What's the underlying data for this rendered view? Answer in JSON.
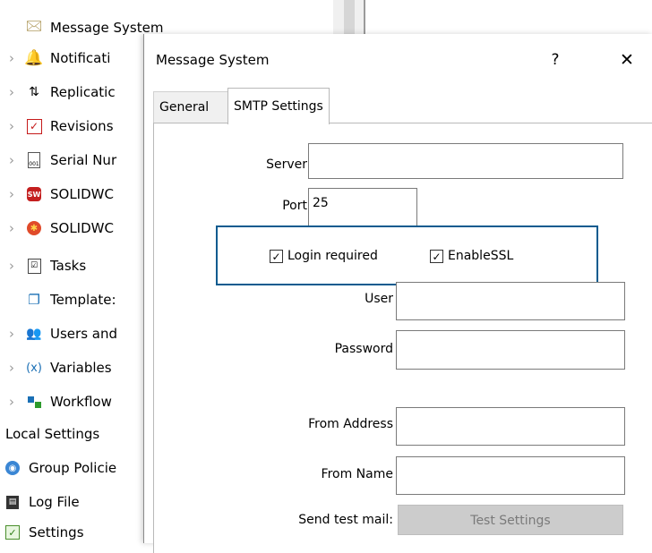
{
  "tree": {
    "top_item": {
      "label": "Message System",
      "icon": "mail-icon"
    },
    "items": [
      {
        "label": "Notificati",
        "icon": "bell-icon"
      },
      {
        "label": "Replicatic",
        "icon": "replication-icon"
      },
      {
        "label": "Revisions",
        "icon": "revisions-check-icon"
      },
      {
        "label": "Serial Nur",
        "icon": "serial-number-icon"
      },
      {
        "label": "SOLIDWC",
        "icon": "solidworks-icon"
      },
      {
        "label": "SOLIDWC",
        "icon": "solidworks-task-icon"
      },
      {
        "label": "Tasks",
        "icon": "tasks-icon"
      },
      {
        "label": "Template:",
        "icon": "templates-icon"
      },
      {
        "label": "Users and",
        "icon": "users-icon"
      },
      {
        "label": "Variables",
        "icon": "variables-icon",
        "glyph": "(x)"
      },
      {
        "label": "Workflow",
        "icon": "workflow-icon"
      }
    ],
    "section_label": "Local Settings",
    "local_items": [
      {
        "label": "Group Policie",
        "icon": "group-policies-icon"
      },
      {
        "label": "Log File",
        "icon": "log-file-icon"
      },
      {
        "label": "Settings",
        "icon": "settings-icon"
      }
    ]
  },
  "dialog": {
    "title": "Message System",
    "help_label": "?",
    "close_label": "✕",
    "tabs": [
      {
        "label": "General",
        "active": false
      },
      {
        "label": "SMTP Settings",
        "active": true
      }
    ],
    "smtp": {
      "server_label": "Server",
      "server_value": "",
      "port_label": "Port",
      "port_value": "25",
      "login_required_label": "Login required",
      "login_required_checked": true,
      "enable_ssl_label": "EnableSSL",
      "enable_ssl_checked": true,
      "user_label": "User",
      "user_value": "",
      "password_label": "Password",
      "password_value": "",
      "from_address_label": "From Address",
      "from_address_value": "",
      "from_name_label": "From Name",
      "from_name_value": "",
      "send_test_label": "Send test mail:",
      "test_button_label": "Test Settings",
      "check_glyph": "✓"
    }
  },
  "colors": {
    "highlight_border": "#0a5b8f",
    "disabled_button_bg": "#cccccc"
  }
}
